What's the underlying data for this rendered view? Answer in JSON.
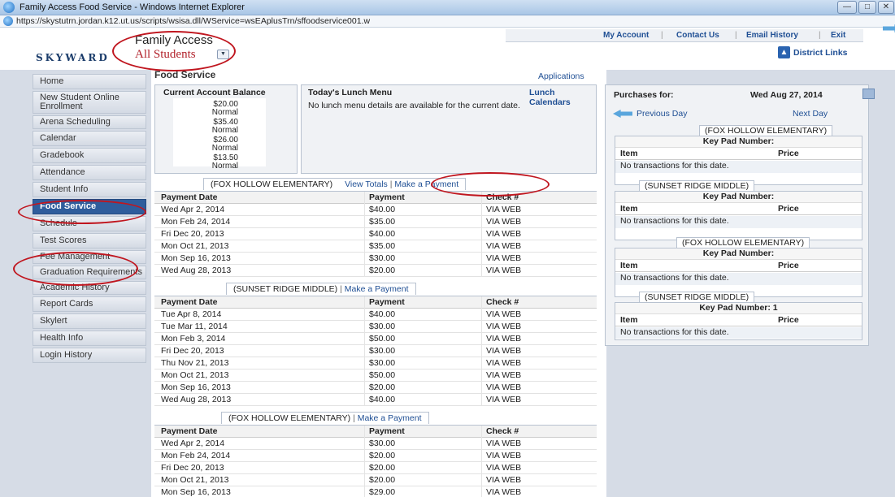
{
  "window": {
    "title": "Family Access Food Service - Windows Internet Explorer",
    "url": "https://skystutrn.jordan.k12.ut.us/scripts/wsisa.dll/WService=wsEAplusTrn/sffoodservice001.w"
  },
  "header": {
    "logo": "SKYWARD",
    "app_title": "Family Access",
    "student_selector": "All Students",
    "nav": [
      "My Account",
      "Contact Us",
      "Email History",
      "Exit"
    ],
    "district_links": "District Links"
  },
  "sidebar": {
    "items": [
      {
        "label": "Home"
      },
      {
        "label": "New Student Online Enrollment"
      },
      {
        "label": "Arena Scheduling"
      },
      {
        "label": "Calendar"
      },
      {
        "label": "Gradebook"
      },
      {
        "label": "Attendance"
      },
      {
        "label": "Student Info"
      },
      {
        "label": "Food Service",
        "active": true
      },
      {
        "label": "Schedule"
      },
      {
        "label": "Test Scores"
      },
      {
        "label": "Fee Management"
      },
      {
        "label": "Graduation Requirements"
      },
      {
        "label": "Academic History"
      },
      {
        "label": "Report Cards"
      },
      {
        "label": "Skylert"
      },
      {
        "label": "Health Info"
      },
      {
        "label": "Login History"
      }
    ]
  },
  "main": {
    "title": "Food Service",
    "applications": "Applications",
    "balance": {
      "heading": "Current Account Balance",
      "entries": [
        {
          "amount": "$20.00",
          "status": "Normal"
        },
        {
          "amount": "$35.40",
          "status": "Normal"
        },
        {
          "amount": "$26.00",
          "status": "Normal"
        },
        {
          "amount": "$13.50",
          "status": "Normal"
        }
      ]
    },
    "lunch": {
      "heading": "Today's Lunch Menu",
      "calendars_link": "Lunch Calendars",
      "message": "No lunch menu details are available for the current date."
    },
    "payment_columns": [
      "Payment Date",
      "Payment",
      "Check #"
    ],
    "view_totals": "View Totals",
    "make_payment": "Make a Payment",
    "payment_groups": [
      {
        "school": "(FOX HOLLOW ELEMENTARY)",
        "rows": [
          [
            "Wed Apr 2, 2014",
            "$40.00",
            "VIA WEB"
          ],
          [
            "Mon Feb 24, 2014",
            "$35.00",
            "VIA WEB"
          ],
          [
            "Fri Dec 20, 2013",
            "$40.00",
            "VIA WEB"
          ],
          [
            "Mon Oct 21, 2013",
            "$35.00",
            "VIA WEB"
          ],
          [
            "Mon Sep 16, 2013",
            "$30.00",
            "VIA WEB"
          ],
          [
            "Wed Aug 28, 2013",
            "$20.00",
            "VIA WEB"
          ]
        ]
      },
      {
        "school": "(SUNSET RIDGE MIDDLE)",
        "rows": [
          [
            "Tue Apr 8, 2014",
            "$40.00",
            "VIA WEB"
          ],
          [
            "Tue Mar 11, 2014",
            "$30.00",
            "VIA WEB"
          ],
          [
            "Mon Feb 3, 2014",
            "$50.00",
            "VIA WEB"
          ],
          [
            "Fri Dec 20, 2013",
            "$30.00",
            "VIA WEB"
          ],
          [
            "Thu Nov 21, 2013",
            "$30.00",
            "VIA WEB"
          ],
          [
            "Mon Oct 21, 2013",
            "$50.00",
            "VIA WEB"
          ],
          [
            "Mon Sep 16, 2013",
            "$20.00",
            "VIA WEB"
          ],
          [
            "Wed Aug 28, 2013",
            "$40.00",
            "VIA WEB"
          ]
        ]
      },
      {
        "school": "(FOX HOLLOW ELEMENTARY)",
        "rows": [
          [
            "Wed Apr 2, 2014",
            "$30.00",
            "VIA WEB"
          ],
          [
            "Mon Feb 24, 2014",
            "$20.00",
            "VIA WEB"
          ],
          [
            "Fri Dec 20, 2013",
            "$20.00",
            "VIA WEB"
          ],
          [
            "Mon Oct 21, 2013",
            "$20.00",
            "VIA WEB"
          ],
          [
            "Mon Sep 16, 2013",
            "$29.00",
            "VIA WEB"
          ]
        ]
      }
    ]
  },
  "purchases": {
    "label": "Purchases for:",
    "date": "Wed Aug 27, 2014",
    "previous": "Previous Day",
    "next": "Next Day",
    "keypad_label": "Key Pad Number:",
    "item_col": "Item",
    "price_col": "Price",
    "empty": "No transactions for this date.",
    "students": [
      {
        "school": "(FOX HOLLOW ELEMENTARY)",
        "keypad": ""
      },
      {
        "school": "(SUNSET RIDGE MIDDLE)",
        "keypad": ""
      },
      {
        "school": "(FOX HOLLOW ELEMENTARY)",
        "keypad": ""
      },
      {
        "school": "(SUNSET RIDGE MIDDLE)",
        "keypad": "1"
      }
    ]
  },
  "colors": {
    "accent": "#2f5d9c",
    "link": "#1f4f94",
    "annotation": "#c0161f",
    "brand_red": "#b2222b"
  }
}
